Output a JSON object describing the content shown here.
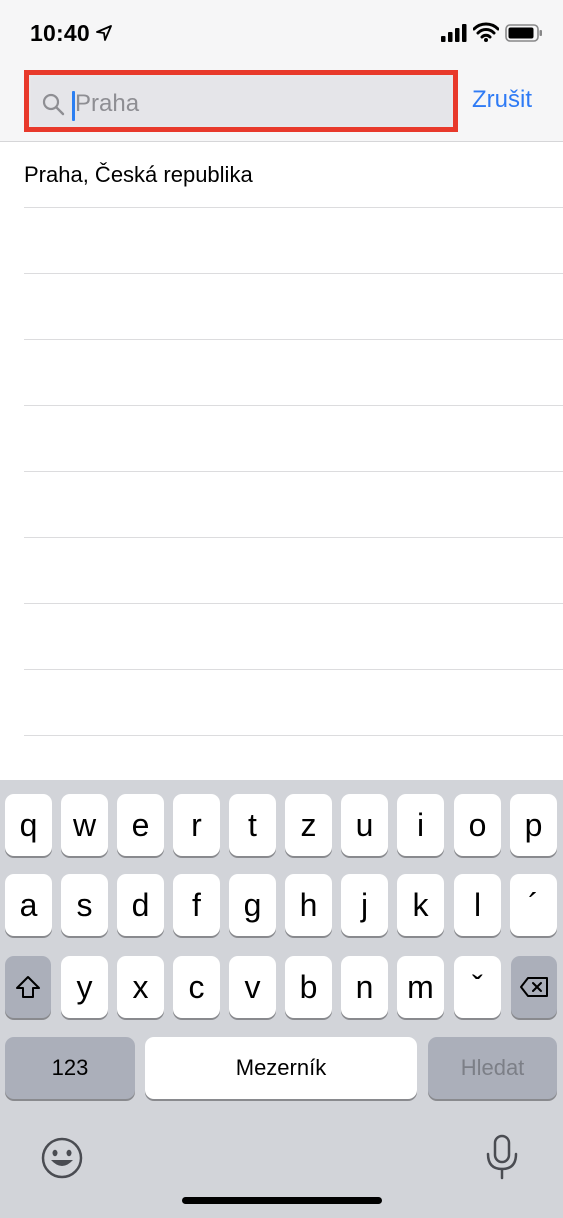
{
  "status_bar": {
    "time": "10:40",
    "icons": [
      "location-arrow-icon",
      "cellular-signal-icon",
      "wifi-icon",
      "battery-icon"
    ]
  },
  "search": {
    "placeholder": "Praha",
    "value": "",
    "cancel_label": "Zrušit",
    "highlight_color": "#e8392b",
    "accent_color": "#2f7bf5"
  },
  "results": {
    "items": [
      "Praha, Česká republika"
    ]
  },
  "keyboard": {
    "row1": [
      "q",
      "w",
      "e",
      "r",
      "t",
      "z",
      "u",
      "i",
      "o",
      "p"
    ],
    "row2": [
      "a",
      "s",
      "d",
      "f",
      "g",
      "h",
      "j",
      "k",
      "l",
      "´"
    ],
    "row3": [
      "y",
      "x",
      "c",
      "v",
      "b",
      "n",
      "m",
      "ˇ"
    ],
    "numbers_label": "123",
    "space_label": "Mezerník",
    "search_label": "Hledat",
    "icons": [
      "shift-icon",
      "backspace-icon",
      "emoji-icon",
      "microphone-icon"
    ]
  }
}
